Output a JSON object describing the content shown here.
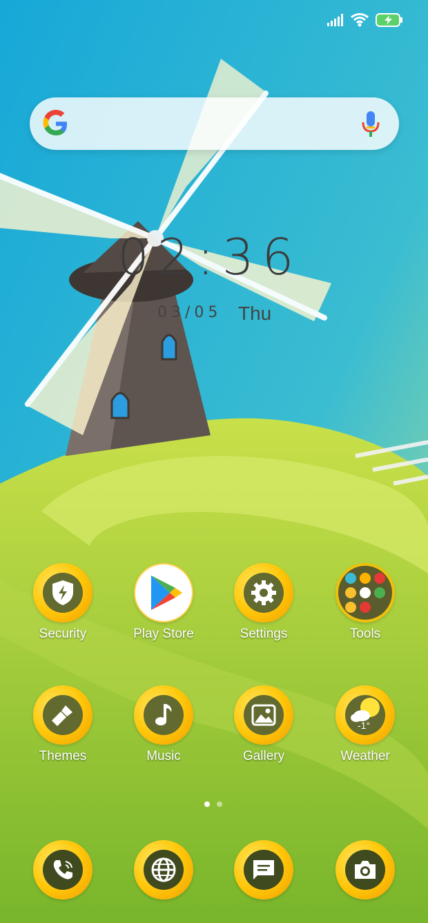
{
  "status": {
    "signal_icon": "signal-icon",
    "wifi_icon": "wifi-icon",
    "battery_icon": "battery-charging-icon"
  },
  "search": {
    "logo_icon": "google-g-icon",
    "mic_icon": "mic-icon"
  },
  "clock": {
    "time": "02:36",
    "date": "03/05",
    "weekday": "Thu"
  },
  "apps_row1": [
    {
      "label": "Security",
      "icon": "shield-icon"
    },
    {
      "label": "Play Store",
      "icon": "play-store-icon"
    },
    {
      "label": "Settings",
      "icon": "gear-icon"
    },
    {
      "label": "Tools",
      "icon": "folder-icon"
    }
  ],
  "apps_row2": [
    {
      "label": "Themes",
      "icon": "brush-icon"
    },
    {
      "label": "Music",
      "icon": "music-note-icon"
    },
    {
      "label": "Gallery",
      "icon": "image-icon"
    },
    {
      "label": "Weather",
      "icon": "weather-icon",
      "temp": "-1°"
    }
  ],
  "dock": [
    {
      "icon": "phone-icon"
    },
    {
      "icon": "browser-globe-icon"
    },
    {
      "icon": "messages-icon"
    },
    {
      "icon": "camera-icon"
    }
  ],
  "pager": {
    "pages": 2,
    "active": 1
  }
}
